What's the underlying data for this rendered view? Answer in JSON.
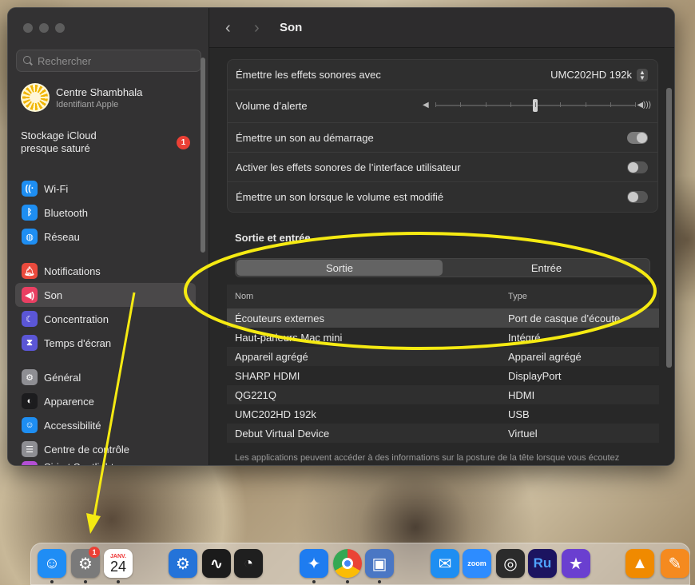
{
  "sidebar": {
    "search_placeholder": "Rechercher",
    "account": {
      "name": "Centre Shambhala",
      "subtitle": "Identifiant Apple"
    },
    "icloud": {
      "line1": "Stockage iCloud",
      "line2": "presque saturé",
      "badge": "1"
    },
    "items": [
      {
        "label": "Wi-Fi",
        "icon": "wifi-icon",
        "color": "#1e8ef2"
      },
      {
        "label": "Bluetooth",
        "icon": "bluetooth-icon",
        "color": "#1e8ef2"
      },
      {
        "label": "Réseau",
        "icon": "globe-icon",
        "color": "#1e8ef2"
      },
      {
        "label": "Notifications",
        "icon": "bell-icon",
        "color": "#ea4a3d"
      },
      {
        "label": "Son",
        "icon": "speaker-icon",
        "color": "#ea3f62"
      },
      {
        "label": "Concentration",
        "icon": "moon-icon",
        "color": "#5b56d6"
      },
      {
        "label": "Temps d'écran",
        "icon": "hourglass-icon",
        "color": "#5b56d6"
      },
      {
        "label": "Général",
        "icon": "gear-icon",
        "color": "#8e8e93"
      },
      {
        "label": "Apparence",
        "icon": "appearance-icon",
        "color": "#1c1c1e"
      },
      {
        "label": "Accessibilité",
        "icon": "accessibility-icon",
        "color": "#1e8ef2"
      },
      {
        "label": "Centre de contrôle",
        "icon": "control-center-icon",
        "color": "#8e8e93"
      },
      {
        "label": "Siri et Spotlight",
        "icon": "siri-icon",
        "color": "#b44fd4"
      }
    ]
  },
  "toolbar": {
    "title": "Son"
  },
  "effects": {
    "alert_device_label": "Émettre les effets sonores avec",
    "alert_device_value": "UMC202HD 192k",
    "alert_volume_label": "Volume d’alerte",
    "alert_volume_level": 0.5,
    "startup_label": "Émettre un son au démarrage",
    "startup_on": true,
    "ui_effects_label": "Activer les effets sonores de l’interface utilisateur",
    "ui_effects_on": false,
    "volume_feedback_label": "Émettre un son lorsque le volume est modifié",
    "volume_feedback_on": false
  },
  "io": {
    "title": "Sortie et entrée",
    "tabs": [
      "Sortie",
      "Entrée"
    ],
    "selected_tab": "Sortie",
    "columns": [
      "Nom",
      "Type"
    ],
    "devices": [
      {
        "name": "Écouteurs externes",
        "type": "Port de casque d’écoute",
        "selected": true
      },
      {
        "name": "Haut-parleurs Mac mini",
        "type": "Intégré"
      },
      {
        "name": "Appareil agrégé",
        "type": "Appareil agrégé"
      },
      {
        "name": "SHARP HDMI",
        "type": "DisplayPort"
      },
      {
        "name": "QG221Q",
        "type": "HDMI"
      },
      {
        "name": "UMC202HD 192k",
        "type": "USB"
      },
      {
        "name": "Debut Virtual Device",
        "type": "Virtuel"
      }
    ],
    "footnote": "Les applications peuvent accéder à des informations sur la posture de la tête lorsque vous écoutez"
  },
  "annotation_color": "#f5ea12",
  "dock": {
    "system_settings_badge": "1",
    "calendar_month": "JANV.",
    "calendar_day": "24",
    "apps": [
      {
        "name": "finder-icon",
        "color": "#1f8df5"
      },
      {
        "name": "system-settings-icon",
        "color": "#7a7a7a"
      },
      {
        "name": "calendar-icon",
        "color": "#ffffff"
      },
      {
        "name": "gear-app-icon",
        "color": "#2473d9"
      },
      {
        "name": "activity-monitor-icon",
        "color": "#1b1b1b"
      },
      {
        "name": "speedometer-icon",
        "color": "#1f1f1f"
      },
      {
        "name": "safari-icon",
        "color": "#1e7cf0"
      },
      {
        "name": "chrome-icon",
        "color": "#ffffff"
      },
      {
        "name": "preview-icon",
        "color": "#4a77c4"
      },
      {
        "name": "mail-icon",
        "color": "#1e8ef2"
      },
      {
        "name": "zoom-icon",
        "color": "#2d8cff"
      },
      {
        "name": "obs-icon",
        "color": "#2b2b2b"
      },
      {
        "name": "rush-icon",
        "color": "#1c1460"
      },
      {
        "name": "imovie-icon",
        "color": "#6a3fd0"
      },
      {
        "name": "vlc-icon",
        "color": "#f08a00"
      },
      {
        "name": "pages-icon",
        "color": "#f58a1f"
      }
    ],
    "zoom_label": "zoom",
    "rush_label": "Ru"
  }
}
